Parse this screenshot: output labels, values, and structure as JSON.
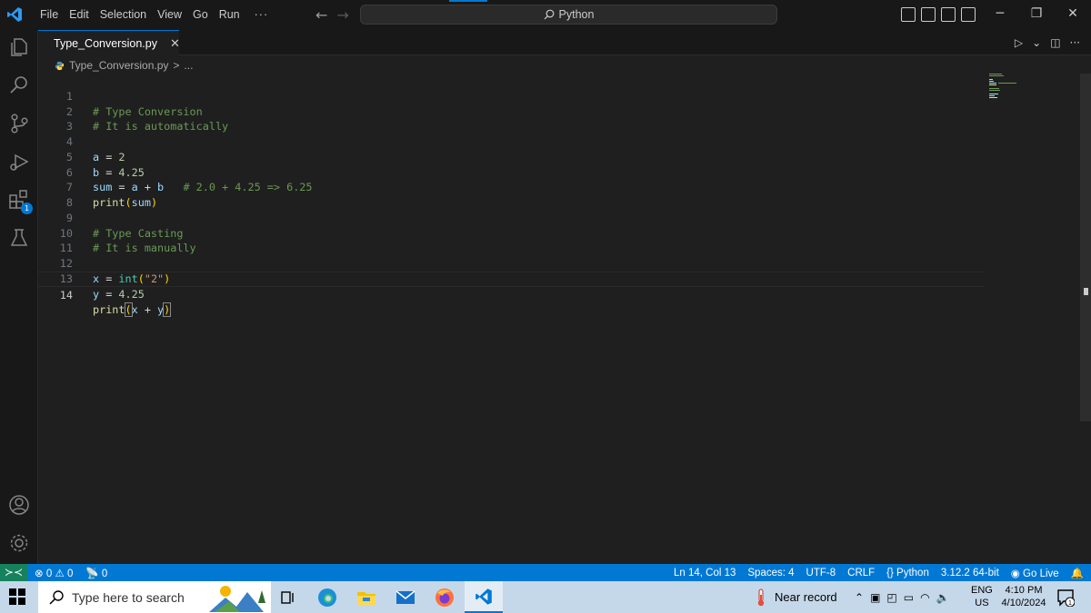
{
  "titlebar": {
    "menu": [
      "File",
      "Edit",
      "Selection",
      "View",
      "Go",
      "Run",
      "···"
    ],
    "search": "Python",
    "window_controls": [
      "─",
      "❐",
      "✕"
    ]
  },
  "tab": {
    "filename": "Type_Conversion.py",
    "close": "✕"
  },
  "editor_actions": {
    "run": "▷",
    "run_menu": "⌄",
    "split": "◫",
    "more": "···"
  },
  "breadcrumb": {
    "file": "Type_Conversion.py",
    "sep": ">",
    "rest": "..."
  },
  "activity_badge": "1",
  "editor": {
    "line_numbers": [
      "1",
      "2",
      "3",
      "4",
      "5",
      "6",
      "7",
      "8",
      "9",
      "10",
      "11",
      "12",
      "13",
      "14"
    ],
    "active_line": 14
  },
  "code": {
    "l1": "# Type Conversion",
    "l2": "# It is automatically",
    "l4_var": "a",
    "l4_op": " = ",
    "l4_num": "2",
    "l5_var": "b",
    "l5_op": " = ",
    "l5_num": "4.25",
    "l6_var": "sum",
    "l6_op": " = ",
    "l6_a": "a",
    "l6_plus": " + ",
    "l6_b": "b",
    "l6_comment": "   # 2.0 + 4.25 => 6.25",
    "l7_func": "print",
    "l7_open": "(",
    "l7_arg": "sum",
    "l7_close": ")",
    "l9": "# Type Casting",
    "l10": "# It is manually",
    "l12_var": "x",
    "l12_op": " = ",
    "l12_type": "int",
    "l12_open": "(",
    "l12_str": "\"2\"",
    "l12_close": ")",
    "l13_var": "y",
    "l13_op": " = ",
    "l13_num": "4.25",
    "l14_func": "print",
    "l14_open": "(",
    "l14_x": "x",
    "l14_plus": " + ",
    "l14_y": "y",
    "l14_close": ")"
  },
  "statusbar": {
    "remote": "≻≺",
    "errors": "⊗ 0",
    "warnings": "⚠ 0",
    "ports": "📡 0",
    "position": "Ln 14, Col 13",
    "spaces": "Spaces: 4",
    "encoding": "UTF-8",
    "eol": "CRLF",
    "language": "{} Python",
    "interpreter": "3.12.2 64-bit",
    "golive": "Go Live",
    "bell": "🔔"
  },
  "taskbar": {
    "search_placeholder": "Type here to search",
    "weather": "Near record",
    "lang_line1": "ENG",
    "lang_line2": "US",
    "time": "4:10 PM",
    "date": "4/10/2024",
    "notif_count": "1"
  },
  "colors": {
    "accent": "#0078d4",
    "comment": "#6a9955",
    "variable": "#9cdcfe",
    "number": "#b5cea8",
    "string": "#ce9178",
    "function": "#dcdcaa"
  }
}
